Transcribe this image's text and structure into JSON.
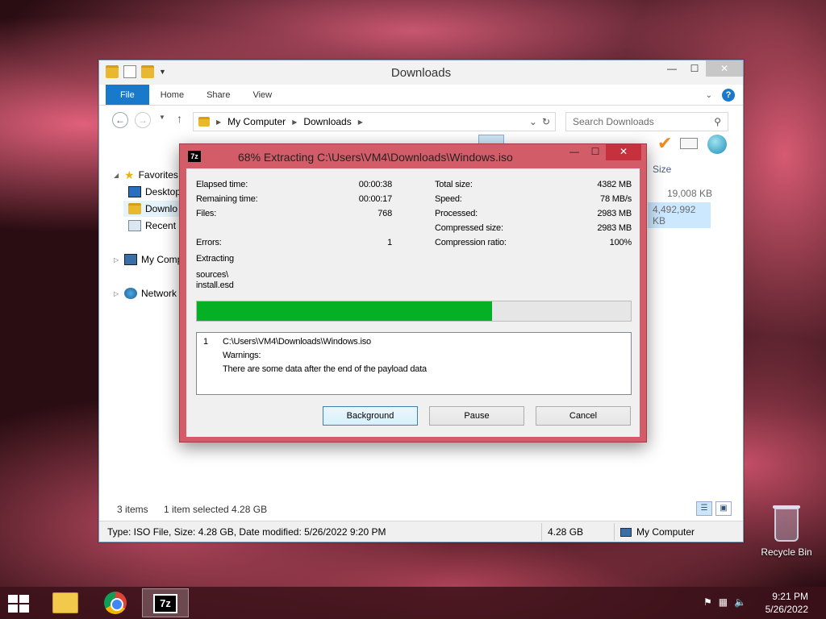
{
  "explorer": {
    "title": "Downloads",
    "ribbon_tabs": [
      "File",
      "Home",
      "Share",
      "View"
    ],
    "address": {
      "segments": [
        "My Computer",
        "Downloads"
      ]
    },
    "search_placeholder": "Search Downloads",
    "nav": {
      "favorites": "Favorites",
      "desktop": "Desktop",
      "downloads": "Downlo",
      "recent": "Recent p",
      "mycomputer": "My Comp",
      "network": "Network"
    },
    "column_size_header": "Size",
    "rows": [
      {
        "size": "19,008 KB"
      },
      {
        "size": "4,492,992 KB"
      }
    ],
    "status": {
      "items": "3 items",
      "selected": "1 item selected  4.28 GB"
    },
    "details": {
      "info": "Type: ISO File, Size: 4.28 GB, Date modified: 5/26/2022 9:20 PM",
      "size": "4.28 GB",
      "location": "My Computer"
    }
  },
  "dialog": {
    "title": "68% Extracting C:\\Users\\VM4\\Downloads\\Windows.iso",
    "icon_label": "7z",
    "left_stats": [
      {
        "label": "Elapsed time:",
        "value": "00:00:38"
      },
      {
        "label": "Remaining time:",
        "value": "00:00:17"
      },
      {
        "label": "Files:",
        "value": "768"
      },
      {
        "label": "Errors:",
        "value": "1"
      }
    ],
    "right_stats": [
      {
        "label": "Total size:",
        "value": "4382 MB"
      },
      {
        "label": "Speed:",
        "value": "78 MB/s"
      },
      {
        "label": "Processed:",
        "value": "2983 MB"
      },
      {
        "label": "Compressed size:",
        "value": "2983 MB"
      },
      {
        "label": "Compression ratio:",
        "value": "100%"
      }
    ],
    "action": "Extracting",
    "current_file_line1": "sources\\",
    "current_file_line2": "install.esd",
    "progress_percent": 68,
    "log": {
      "index": "1",
      "path": "C:\\Users\\VM4\\Downloads\\Windows.iso",
      "warnings_label": "Warnings:",
      "message": "There are some data after the end of the payload data"
    },
    "buttons": {
      "background": "Background",
      "pause": "Pause",
      "cancel": "Cancel"
    }
  },
  "desktop": {
    "recycle_bin": "Recycle Bin"
  },
  "taskbar": {
    "time": "9:21 PM",
    "date": "5/26/2022"
  },
  "colors": {
    "progress_fill": "#06b025",
    "dialog_frame": "#d25d68",
    "file_tab": "#1979ca"
  }
}
